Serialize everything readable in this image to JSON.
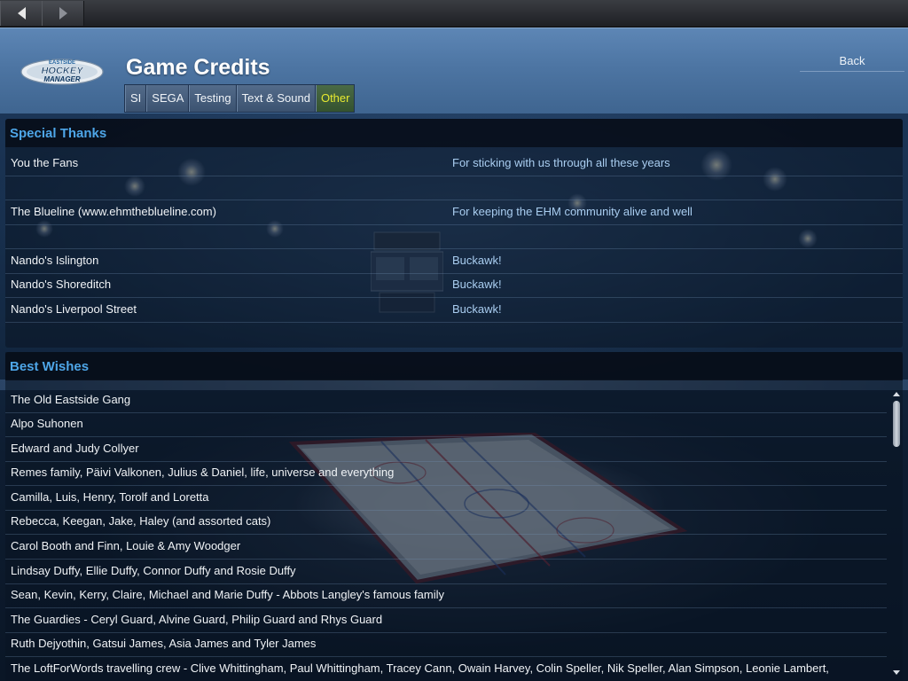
{
  "nav": {
    "back_icon": "arrow-left-icon",
    "forward_icon": "arrow-right-icon"
  },
  "header": {
    "logo_text_top": "EASTSIDE",
    "logo_text_mid": "HOCKEY",
    "logo_text_bot": "MANAGER",
    "title": "Game Credits",
    "back_label": "Back",
    "tabs": [
      {
        "label": "SI",
        "active": false
      },
      {
        "label": "SEGA",
        "active": false
      },
      {
        "label": "Testing",
        "active": false
      },
      {
        "label": "Text & Sound",
        "active": false
      },
      {
        "label": "Other",
        "active": true
      }
    ]
  },
  "special_thanks": {
    "title": "Special Thanks",
    "rows": [
      {
        "name": "You the Fans",
        "reason": "For sticking with us through all these years"
      },
      {
        "name": "",
        "reason": ""
      },
      {
        "name": "The Blueline (www.ehmtheblueline.com)",
        "reason": "For keeping the EHM community alive and well"
      },
      {
        "name": "",
        "reason": ""
      },
      {
        "name": "Nando's Islington",
        "reason": "Buckawk!"
      },
      {
        "name": "Nando's Shoreditch",
        "reason": "Buckawk!"
      },
      {
        "name": "Nando's Liverpool Street",
        "reason": "Buckawk!"
      }
    ]
  },
  "best_wishes": {
    "title": "Best Wishes",
    "rows": [
      "The Old Eastside Gang",
      "Alpo Suhonen",
      "Edward and Judy Collyer",
      "Remes family, Päivi Valkonen, Julius & Daniel, life, universe and everything",
      "Camilla, Luis, Henry, Torolf and Loretta",
      "Rebecca, Keegan, Jake, Haley (and assorted cats)",
      "Carol Booth and Finn, Louie & Amy Woodger",
      "Lindsay Duffy, Ellie Duffy, Connor Duffy and Rosie Duffy",
      "Sean, Kevin, Kerry, Claire, Michael and Marie Duffy - Abbots Langley's famous family",
      "The Guardies - Ceryl Guard, Alvine Guard, Philip Guard and Rhys Guard",
      "Ruth Dejyothin, Gatsui James, Asia James and Tyler James",
      "The LoftForWords travelling crew - Clive Whittingham, Paul Whittingham, Tracey Cann, Owain Harvey, Colin Speller, Nik Speller, Alan Simpson, Leonie Lambert,"
    ]
  },
  "colors": {
    "accent_blue": "#4ea6e8",
    "active_tab": "#e8ea30",
    "reason_text": "#a9cdf0",
    "header_blue": "#4d75a3"
  }
}
